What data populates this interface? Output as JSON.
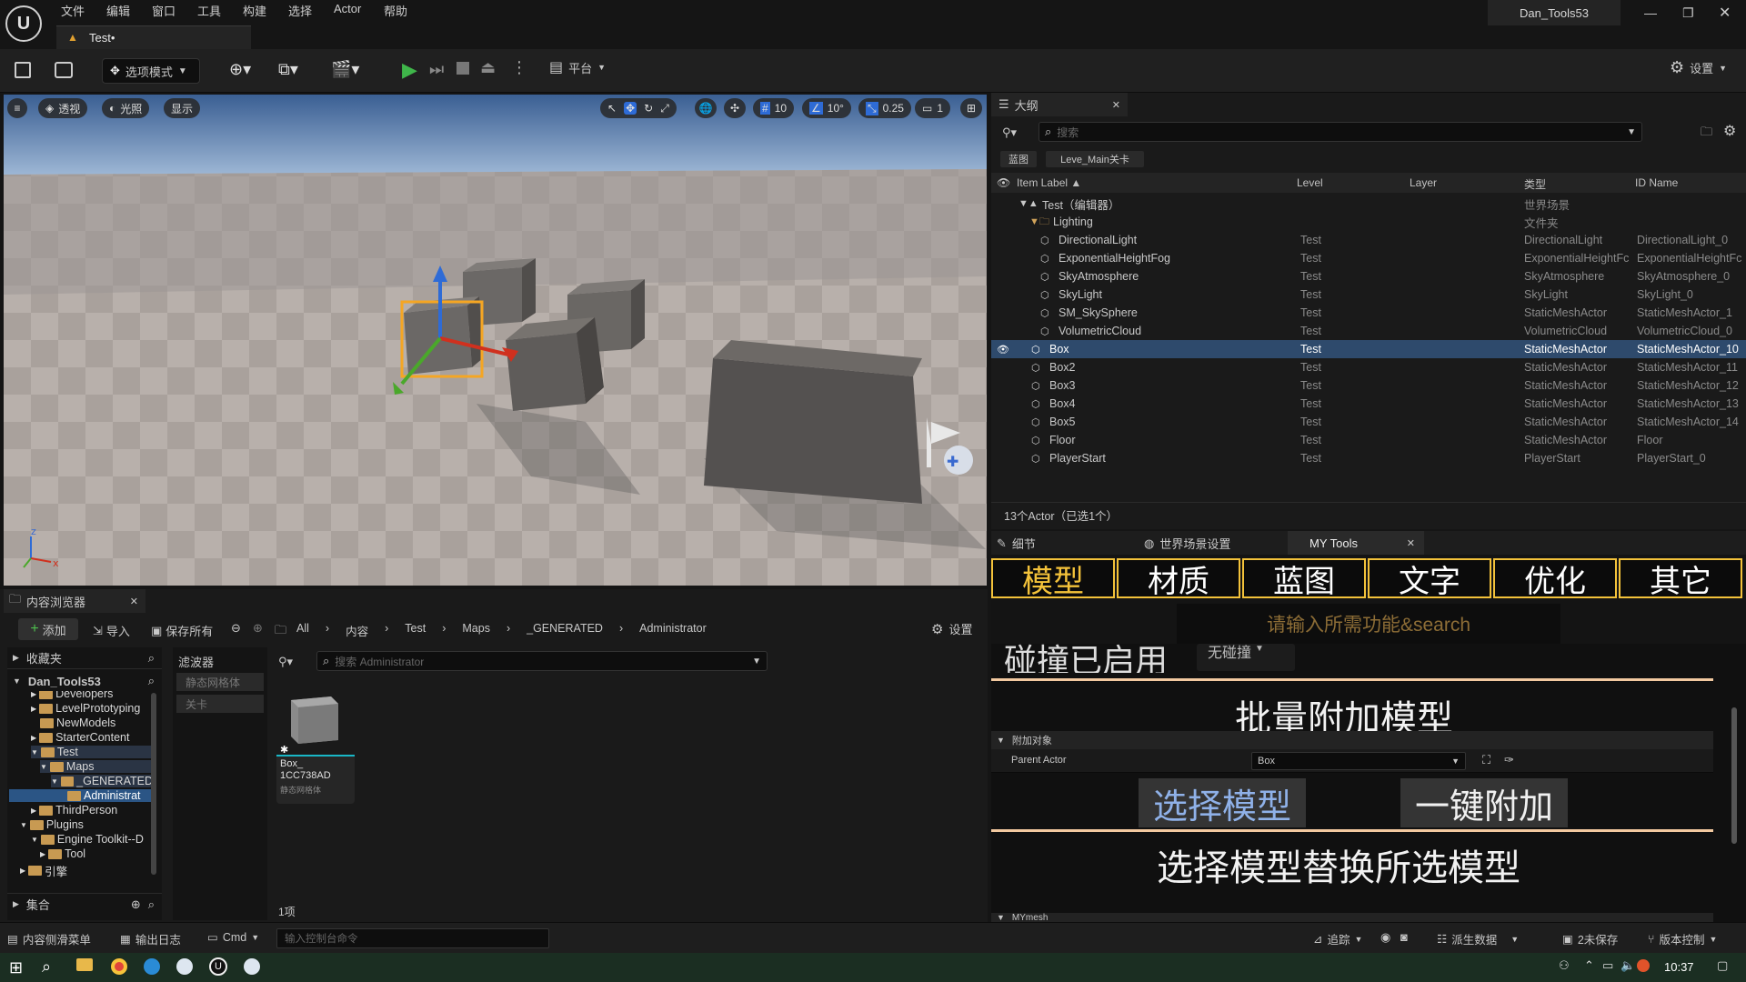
{
  "menubar": {
    "items": [
      "文件",
      "编辑",
      "窗口",
      "工具",
      "构建",
      "选择",
      "Actor",
      "帮助"
    ],
    "project_name": "Dan_Tools53",
    "tab_label": "Test•"
  },
  "toolbar": {
    "mode_label": "选项模式",
    "platform_label": "平台",
    "settings_label": "设置"
  },
  "viewport": {
    "perspective_label": "透视",
    "lighting_label": "光照",
    "show_label": "显示",
    "grid_snap": "10",
    "rotation_snap": "10°",
    "scale_snap": "0.25",
    "camera_speed": "1"
  },
  "outliner": {
    "tab_label": "大纲",
    "search_placeholder": "搜索",
    "filter_chips": [
      "蓝图",
      "Leve_Main关卡"
    ],
    "columns": [
      "Item Label ▲",
      "Level",
      "Layer",
      "类型",
      "ID Name"
    ],
    "rows": [
      {
        "label": "Test（编辑器）",
        "level": "",
        "type": "世界场景",
        "id": ""
      },
      {
        "label": "Lighting",
        "level": "",
        "type": "文件夹",
        "id": ""
      },
      {
        "label": "DirectionalLight",
        "level": "Test",
        "type": "DirectionalLight",
        "id": "DirectionalLight_0"
      },
      {
        "label": "ExponentialHeightFog",
        "level": "Test",
        "type": "ExponentialHeightFc",
        "id": "ExponentialHeightFc"
      },
      {
        "label": "SkyAtmosphere",
        "level": "Test",
        "type": "SkyAtmosphere",
        "id": "SkyAtmosphere_0"
      },
      {
        "label": "SkyLight",
        "level": "Test",
        "type": "SkyLight",
        "id": "SkyLight_0"
      },
      {
        "label": "SM_SkySphere",
        "level": "Test",
        "type": "StaticMeshActor",
        "id": "StaticMeshActor_1"
      },
      {
        "label": "VolumetricCloud",
        "level": "Test",
        "type": "VolumetricCloud",
        "id": "VolumetricCloud_0"
      },
      {
        "label": "Box",
        "level": "Test",
        "type": "StaticMeshActor",
        "id": "StaticMeshActor_10"
      },
      {
        "label": "Box2",
        "level": "Test",
        "type": "StaticMeshActor",
        "id": "StaticMeshActor_11"
      },
      {
        "label": "Box3",
        "level": "Test",
        "type": "StaticMeshActor",
        "id": "StaticMeshActor_12"
      },
      {
        "label": "Box4",
        "level": "Test",
        "type": "StaticMeshActor",
        "id": "StaticMeshActor_13"
      },
      {
        "label": "Box5",
        "level": "Test",
        "type": "StaticMeshActor",
        "id": "StaticMeshActor_14"
      },
      {
        "label": "Floor",
        "level": "Test",
        "type": "StaticMeshActor",
        "id": "Floor"
      },
      {
        "label": "PlayerStart",
        "level": "Test",
        "type": "PlayerStart",
        "id": "PlayerStart_0"
      }
    ],
    "footer": "13个Actor（已选1个）"
  },
  "details": {
    "tabs": [
      "细节",
      "世界场景设置",
      "MY Tools"
    ],
    "tool_tabs": [
      "模型",
      "材质",
      "蓝图",
      "文字",
      "优化",
      "其它"
    ],
    "search_placeholder": "请输入所需功能&search",
    "partial_heading": "碰撞已启用",
    "collision_value": "无碰撞",
    "section_title_1": "批量附加模型",
    "attach_category": "附加对象",
    "parent_actor_label": "Parent Actor",
    "parent_actor_value": "Box",
    "select_model_btn": "选择模型",
    "attach_btn": "一键附加",
    "section_title_2": "选择模型替换所选模型",
    "bottom_category": "MYmesh"
  },
  "content_browser": {
    "tab_label": "内容浏览器",
    "add_label": "添加",
    "import_label": "导入",
    "save_all_label": "保存所有",
    "breadcrumb": [
      "All",
      "内容",
      "Test",
      "Maps",
      "_GENERATED",
      "Administrator"
    ],
    "settings_label": "设置",
    "favorites_label": "收藏夹",
    "project_root": "Dan_Tools53",
    "tree": [
      "Developers",
      "LevelPrototyping",
      "NewModels",
      "StarterContent",
      "Test",
      "Maps",
      "_GENERATED",
      "Administrat",
      "ThirdPerson",
      "Plugins",
      "Engine Toolkit--D",
      "Tool",
      "引擎"
    ],
    "collections_label": "集合",
    "filters_label": "滤波器",
    "filter_items": [
      "静态网格体",
      "关卡"
    ],
    "search_placeholder": "搜索 Administrator",
    "asset_name": "Box_\n1CC738AD",
    "asset_type": "静态网格体",
    "item_count": "1项"
  },
  "statusbar": {
    "content_drawer": "内容侧滑菜单",
    "output_log": "输出日志",
    "cmd_label": "Cmd",
    "console_placeholder": "输入控制台命令",
    "trace_label": "追踪",
    "derived_data": "派生数据",
    "unsaved": "2未保存",
    "version_control": "版本控制"
  },
  "taskbar": {
    "time": "10:37"
  }
}
